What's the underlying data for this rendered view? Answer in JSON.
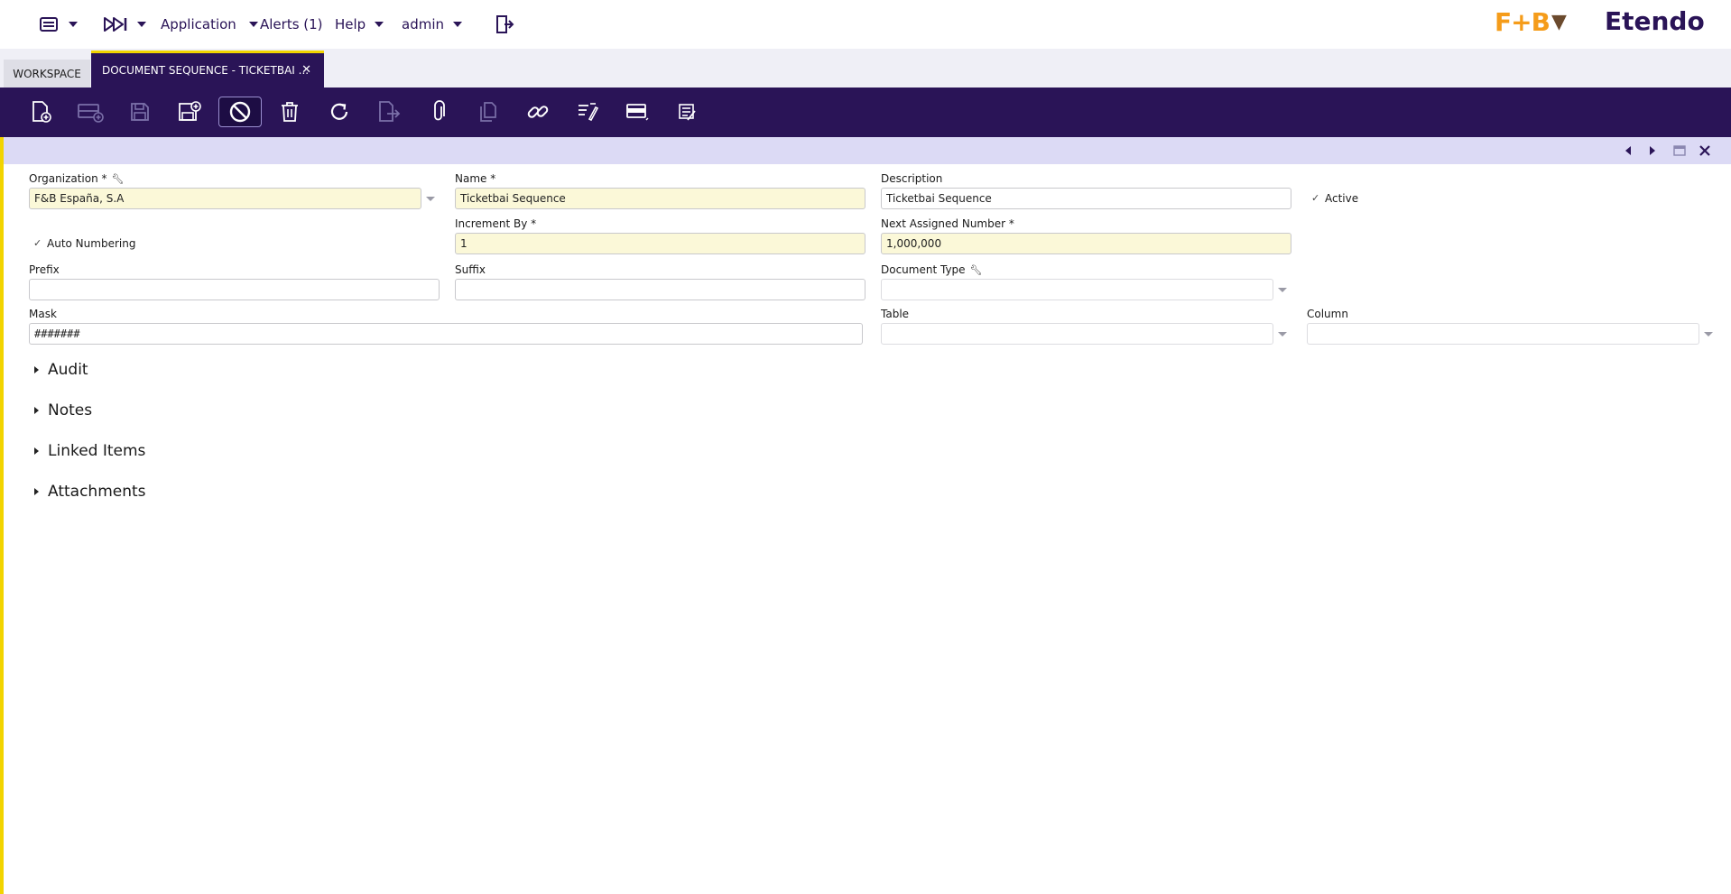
{
  "nav": {
    "application": "Application",
    "alerts": "Alerts (1)",
    "help": "Help",
    "user": "admin"
  },
  "brand": {
    "fb": "F+B",
    "etendo": "Etendo"
  },
  "tabs": {
    "workspace": "WORKSPACE",
    "active": "DOCUMENT SEQUENCE - TICKETBAI ...",
    "close": "✕"
  },
  "toolbar_icons": [
    "new-document-icon",
    "new-row-icon",
    "save-icon",
    "save-close-icon",
    "undo-icon",
    "delete-icon",
    "refresh-icon",
    "export-icon",
    "attach-icon",
    "clone-icon",
    "link-icon",
    "audit-icon",
    "grid-view-icon",
    "notes-icon"
  ],
  "form": {
    "organization": {
      "label": "Organization *",
      "value": "F&B España, S.A"
    },
    "name": {
      "label": "Name *",
      "value": "Ticketbai Sequence"
    },
    "description": {
      "label": "Description",
      "value": "Ticketbai Sequence"
    },
    "active": {
      "label": "Active",
      "checked": true
    },
    "auto_numbering": {
      "label": "Auto Numbering",
      "checked": true
    },
    "increment_by": {
      "label": "Increment By *",
      "value": "1"
    },
    "next_assigned": {
      "label": "Next Assigned Number *",
      "value": "1,000,000"
    },
    "prefix": {
      "label": "Prefix",
      "value": ""
    },
    "suffix": {
      "label": "Suffix",
      "value": ""
    },
    "document_type": {
      "label": "Document Type",
      "value": ""
    },
    "mask": {
      "label": "Mask",
      "value": "#######"
    },
    "table": {
      "label": "Table",
      "value": ""
    },
    "column": {
      "label": "Column",
      "value": ""
    }
  },
  "sections": [
    "Audit",
    "Notes",
    "Linked Items",
    "Attachments"
  ],
  "colors": {
    "brand": "#2a1457",
    "accent": "#f2d400",
    "required_bg": "#fbf8d8",
    "subbar": "#dcdaf5"
  }
}
